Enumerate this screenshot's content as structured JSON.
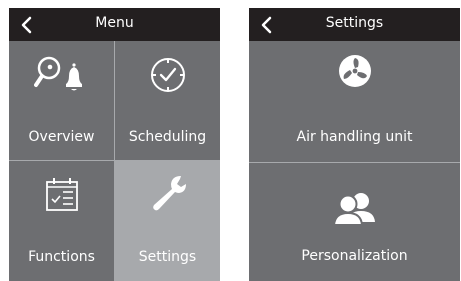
{
  "menu_screen": {
    "title": "Menu",
    "tiles": [
      {
        "label": "Overview",
        "icon": "overview-icon"
      },
      {
        "label": "Scheduling",
        "icon": "clock-icon"
      },
      {
        "label": "Functions",
        "icon": "calendar-list-icon"
      },
      {
        "label": "Settings",
        "icon": "wrench-icon",
        "selected": true
      }
    ]
  },
  "settings_screen": {
    "title": "Settings",
    "tiles": [
      {
        "label": "Air handling unit",
        "icon": "fan-icon"
      },
      {
        "label": "Personalization",
        "icon": "users-icon"
      }
    ]
  },
  "colors": {
    "topbar": "#231f20",
    "tile_background": "#6d6e71",
    "tile_selected": "#a7a9ac",
    "text": "#ffffff"
  }
}
